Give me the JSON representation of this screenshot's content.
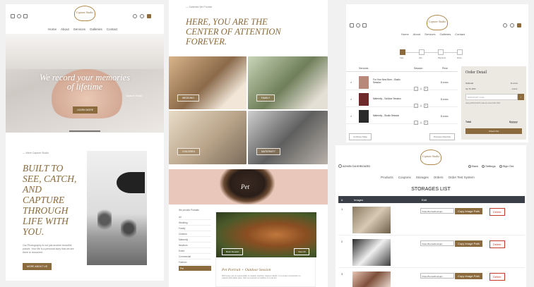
{
  "panel1": {
    "brand": "Capture Studio",
    "nav": [
      "Home",
      "About",
      "Services",
      "Galleries",
      "Contact"
    ],
    "hero_title_line1": "We record your memories",
    "hero_title_line2": "of lifetime",
    "hero_credit": "Capture Studio",
    "hero_button": "LEARN MORE",
    "about_kicker": "— Were Capture Studio",
    "about_heading": [
      "BUILT TO",
      "SEE, CATCH,",
      "AND",
      "CAPTURE",
      "THROUGH",
      "LIFE WITH",
      "YOU."
    ],
    "about_text": "Our Photography is not just another beautiful picture. Your life is a personal story that we are there to document.",
    "about_button": "MORE ABOUT US"
  },
  "panel2": {
    "kicker": "— Galleries We Provide",
    "heading": [
      "HERE, YOU ARE THE",
      "CENTER OF ATTENTION",
      "FOREVER."
    ],
    "tags": [
      "WEDDING",
      "FAMILY",
      "CHILDREN",
      "MATERNITY"
    ],
    "banner_text": "Pet",
    "categories_title": "We provide Portraits",
    "categories": [
      "All",
      "Wedding",
      "Family",
      "Children",
      "Maternity",
      "Newborn",
      "Event",
      "Commercial",
      "Fashion",
      "Pet"
    ],
    "active_category": "Pet",
    "card_btn_left": "Book Session",
    "card_btn_right": "View All",
    "card_title": "Pet Portrait + Outdoor Session",
    "card_text": "With every pet of a personality is created, working: Capture Studio, in a unique composition to capture that stable glory. Sets at a session of relation in in pet fun."
  },
  "panel3": {
    "brand": "Capture Studio",
    "nav": [
      "Home",
      "About",
      "Services",
      "Galleries",
      "Contact"
    ],
    "steps": [
      "Cart",
      "Info",
      "Payment",
      "Done"
    ],
    "table_headers": [
      "Services",
      "Session",
      "Price"
    ],
    "items": [
      {
        "name": "For Your New Born - Studio Session",
        "qty": "1",
        "price": "$ xxxxx"
      },
      {
        "name": "Maternity - Outdoor Session",
        "qty": "1",
        "price": "$ xxxxx"
      },
      {
        "name": "Maternity - Studio Session",
        "qty": "1",
        "price": "$ xxxxx"
      }
    ],
    "continue_label": "Continue Shop",
    "back_label": "Previous Attention",
    "order_title": "Order Detail",
    "order_rows": [
      {
        "k": "Subtotal",
        "v": "$ xxxxx"
      },
      {
        "k": "Up To 10%",
        "v": "- xxxxx"
      }
    ],
    "discount_label": "DISCOUNT Code",
    "discount_hint": "Using DISCOUNT code for extra 10% OFF",
    "total_label": "Total",
    "total_value": "$yyyyy",
    "checkout_label": "Check Out"
  },
  "panel4": {
    "brand": "Capture Studio",
    "admin_label": "ADMIN DASHBOARD",
    "actions": [
      "Back",
      "Settings",
      "Sign Out"
    ],
    "nav": [
      "Products",
      "Coupons",
      "Storages",
      "Orders",
      "Order Test System"
    ],
    "title": "STORAGES LIST",
    "headers": [
      "#",
      "Images",
      "Edit"
    ],
    "rows": [
      {
        "n": "1",
        "path": "https://heroschool.ap/...",
        "copy": "Copy Image Path",
        "del": "Delete"
      },
      {
        "n": "2",
        "path": "https://heroschool.ap/...",
        "copy": "Copy Image Path",
        "del": "Delete"
      },
      {
        "n": "3",
        "path": "https://heroschool.ap/...",
        "copy": "Copy Image Path",
        "del": "Delete"
      }
    ]
  },
  "colors": {
    "accent": "#8b6b3d",
    "heading": "#8a6a3a"
  }
}
